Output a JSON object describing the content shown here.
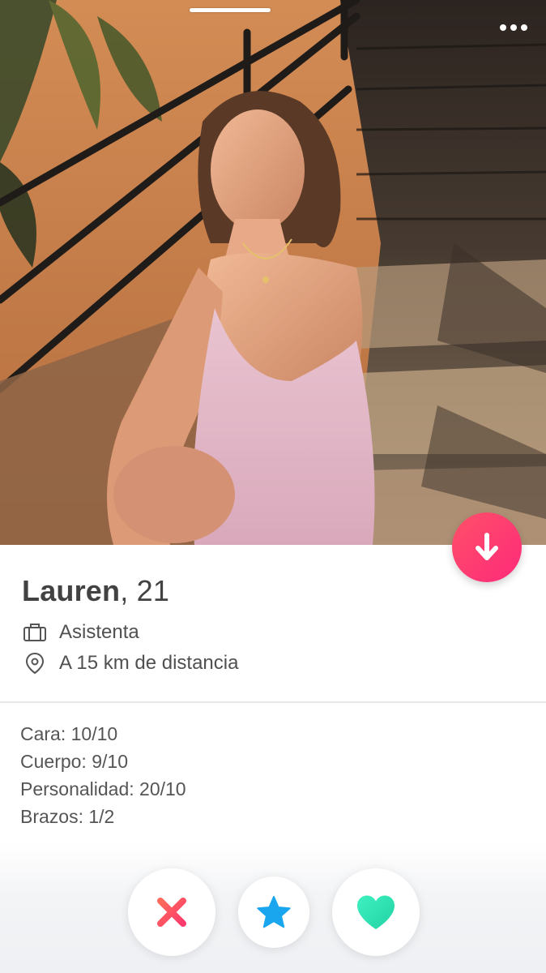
{
  "profile": {
    "name": "Lauren",
    "age_separator": ", ",
    "age": "21",
    "job_icon": "briefcase-icon",
    "job": "Asistenta",
    "distance_icon": "location-pin-icon",
    "distance": "A 15 km de distancia"
  },
  "bio": {
    "lines": [
      "Cara: 10/10",
      "Cuerpo: 9/10",
      "Personalidad: 20/10",
      "Brazos: 1/2"
    ]
  },
  "header": {
    "photo_count": 1,
    "current_photo": 1,
    "more_icon": "more-dots-icon"
  },
  "actions": {
    "collapse_icon": "arrow-down-icon",
    "nope_icon": "x-icon",
    "superlike_icon": "star-icon",
    "like_icon": "heart-icon"
  },
  "colors": {
    "nope": "#fd4d63",
    "superlike": "#1aa6ef",
    "like": "#2ee3b3",
    "collapse_gradient_start": "#fd5068",
    "collapse_gradient_end": "#ff2a7a",
    "text_primary": "#424242",
    "text_secondary": "#505050"
  }
}
